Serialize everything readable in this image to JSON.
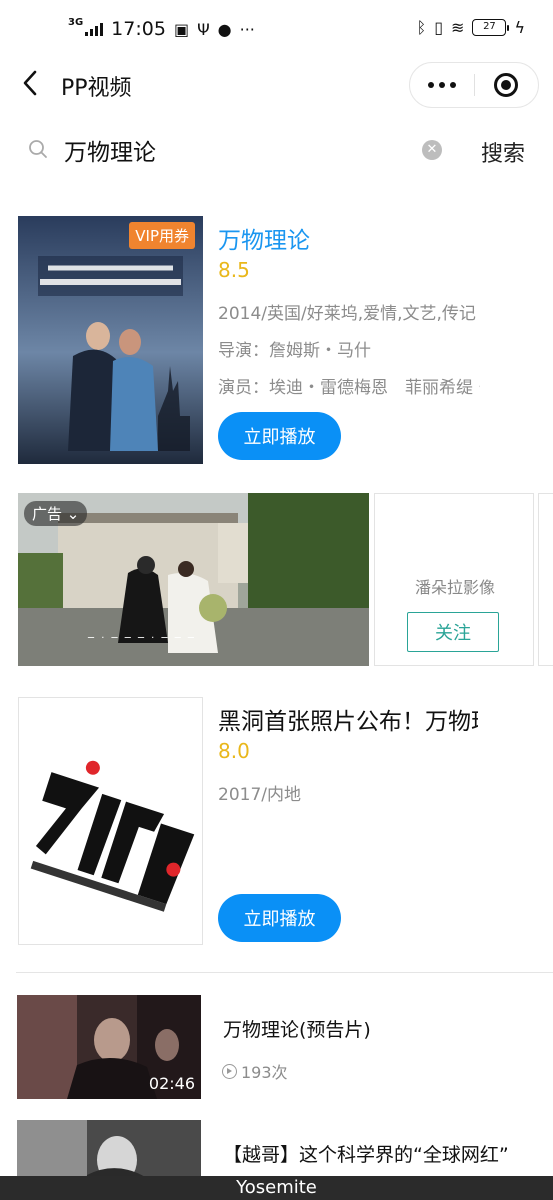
{
  "status_bar": {
    "network": "3G",
    "time": "17:05",
    "battery": "27"
  },
  "navbar": {
    "back_icon": "chevron-left-icon",
    "title": "PP视频"
  },
  "search": {
    "query": "万物理论",
    "button": "搜索"
  },
  "movies": [
    {
      "title": "万物理论",
      "title_color": "#1a96f0",
      "badge": "VIP用券",
      "score": "8.5",
      "meta": "2014/英国/好莱坞,爱情,文艺,传记",
      "director": "导演：詹姆斯・马什",
      "cast": "演员：埃迪・雷德梅恩　菲丽希缇・琼斯",
      "play": "立即播放"
    },
    {
      "title": "黑洞首张照片公布！万物理论",
      "title_color": "#111111",
      "score": "8.0",
      "meta": "2017/内地",
      "play": "立即播放"
    }
  ],
  "ad": {
    "badge": "广告",
    "name": "潘朵拉影像",
    "follow": "关注"
  },
  "videos": [
    {
      "title": "万物理论(预告片)",
      "duration": "02:46",
      "views": "193次"
    },
    {
      "title": "【越哥】这个科学界的“全球网红”"
    }
  ],
  "bottom_label": "Yosemite",
  "colors": {
    "accent": "#0a90f6",
    "score": "#e9b71b",
    "vip": "#f0842f",
    "follow": "#2aa497"
  }
}
